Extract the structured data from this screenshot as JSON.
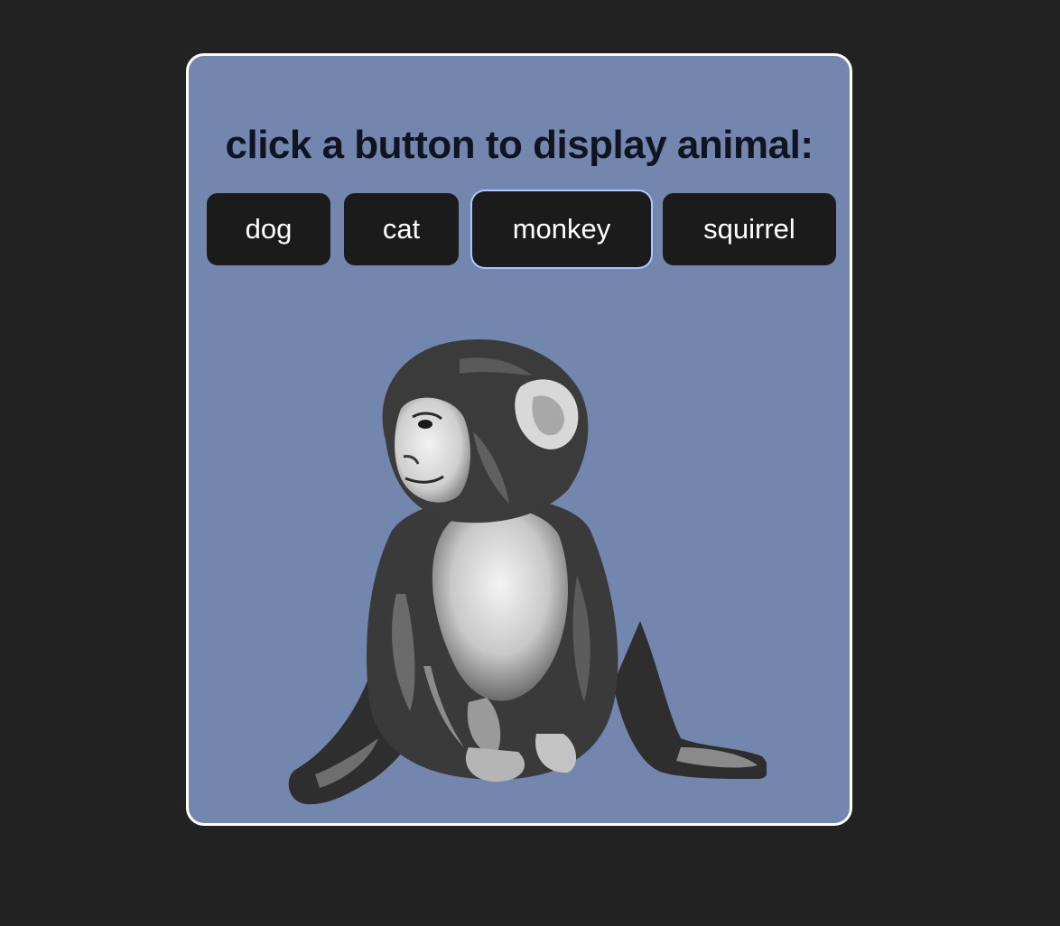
{
  "title": "click a button to display animal:",
  "buttons": [
    {
      "label": "dog",
      "selected": false
    },
    {
      "label": "cat",
      "selected": false
    },
    {
      "label": "monkey",
      "selected": true
    },
    {
      "label": "squirrel",
      "selected": false
    }
  ],
  "displayed_animal": "monkey",
  "colors": {
    "page_background": "#222222",
    "card_background": "#7387ae",
    "card_border": "#ffffff",
    "button_background": "#1b1b1b",
    "button_text": "#ffffff",
    "focus_ring": "#aac8ff",
    "title_text": "#0f1420"
  }
}
